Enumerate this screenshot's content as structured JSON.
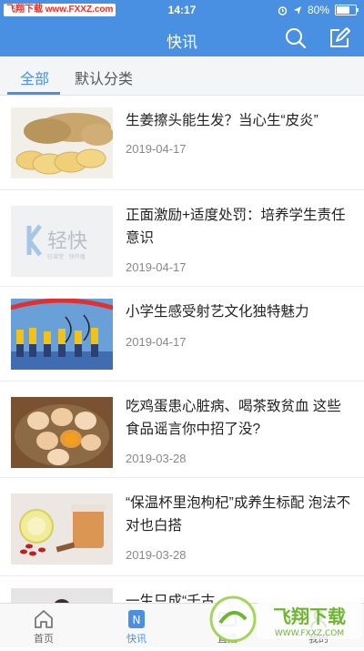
{
  "statusbar": {
    "watermark": "飞翔下载 www.FXXZ.com",
    "time": "14:17",
    "battery": "80%",
    "battery_level": 0.8
  },
  "navbar": {
    "title": "快讯",
    "search_icon": "search-icon",
    "edit_icon": "edit-icon"
  },
  "tabs": [
    {
      "label": "全部",
      "active": true
    },
    {
      "label": "默认分类",
      "active": false
    }
  ],
  "news": [
    {
      "title": "生姜擦头能生发？当心生“皮炎”",
      "date": "2019-04-17",
      "image": "ginger"
    },
    {
      "title": "正面激励+适度处罚：培养学生责任意识",
      "date": "2019-04-17",
      "image": "qingkuai-logo",
      "logo_text": "轻快",
      "logo_subtext": "轻课堂 · 快传播"
    },
    {
      "title": "小学生感受射艺文化独特魅力",
      "date": "2019-04-17",
      "image": "archery"
    },
    {
      "title": "吃鸡蛋患心脏病、喝茶致贫血 这些食品谣言你中招了没?",
      "date": "2019-03-28",
      "image": "eggs"
    },
    {
      "title": "“保温杯里泡枸杞”成养生标配 泡法不对也白搭",
      "date": "2019-03-28",
      "image": "goji-tea"
    },
    {
      "title": "一生只成“千古",
      "date": "",
      "image": "partial"
    }
  ],
  "bottom_tabs": [
    {
      "label": "首页",
      "icon": "home-icon",
      "active": false
    },
    {
      "label": "快讯",
      "icon": "news-icon",
      "active": true
    },
    {
      "label": "直播",
      "icon": "live-icon",
      "active": false
    },
    {
      "label": "我的",
      "icon": "profile-icon",
      "active": false
    }
  ],
  "watermark": {
    "text": "飞翔下载",
    "url": "WWW.FXXZ.COM"
  },
  "colors": {
    "primary": "#4a90e2",
    "text": "#222222",
    "date": "#888888"
  }
}
